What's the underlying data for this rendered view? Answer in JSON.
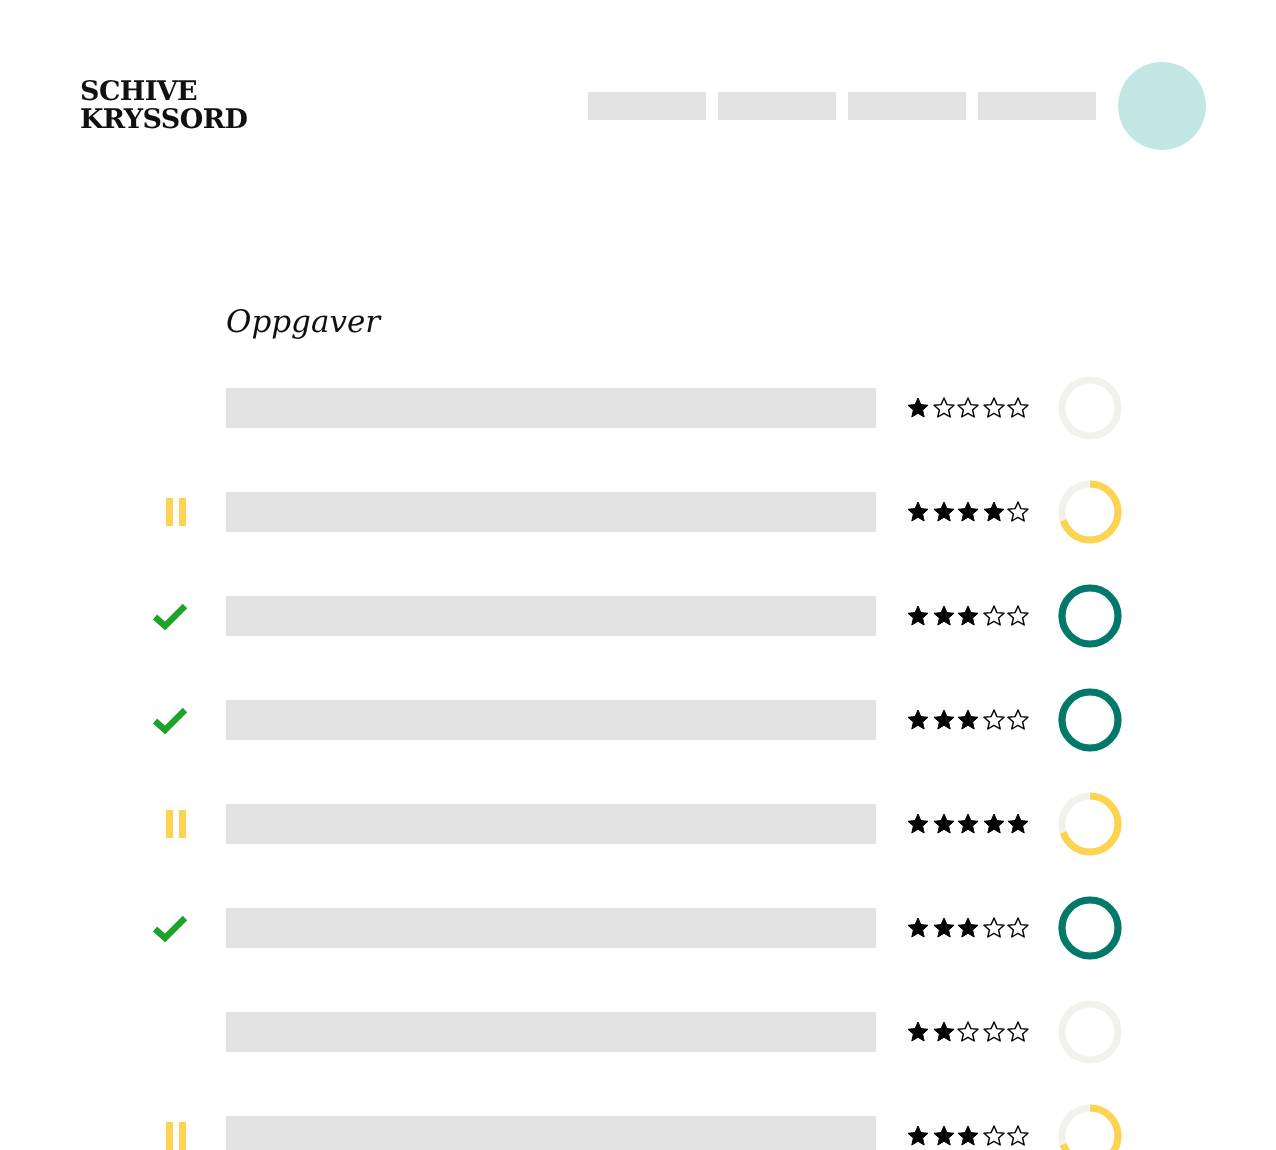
{
  "logo": {
    "lines": [
      "SCHIVE",
      "KRYSSORD"
    ]
  },
  "heading": "Oppgaver",
  "tasks": [
    {
      "kind": "new",
      "stars": 1
    },
    {
      "kind": "paused",
      "stars": 4
    },
    {
      "kind": "done",
      "stars": 3
    },
    {
      "kind": "done",
      "stars": 3
    },
    {
      "kind": "paused",
      "stars": 5
    },
    {
      "kind": "done",
      "stars": 3
    },
    {
      "kind": "new",
      "stars": 2
    },
    {
      "kind": "paused",
      "stars": 3
    }
  ]
}
